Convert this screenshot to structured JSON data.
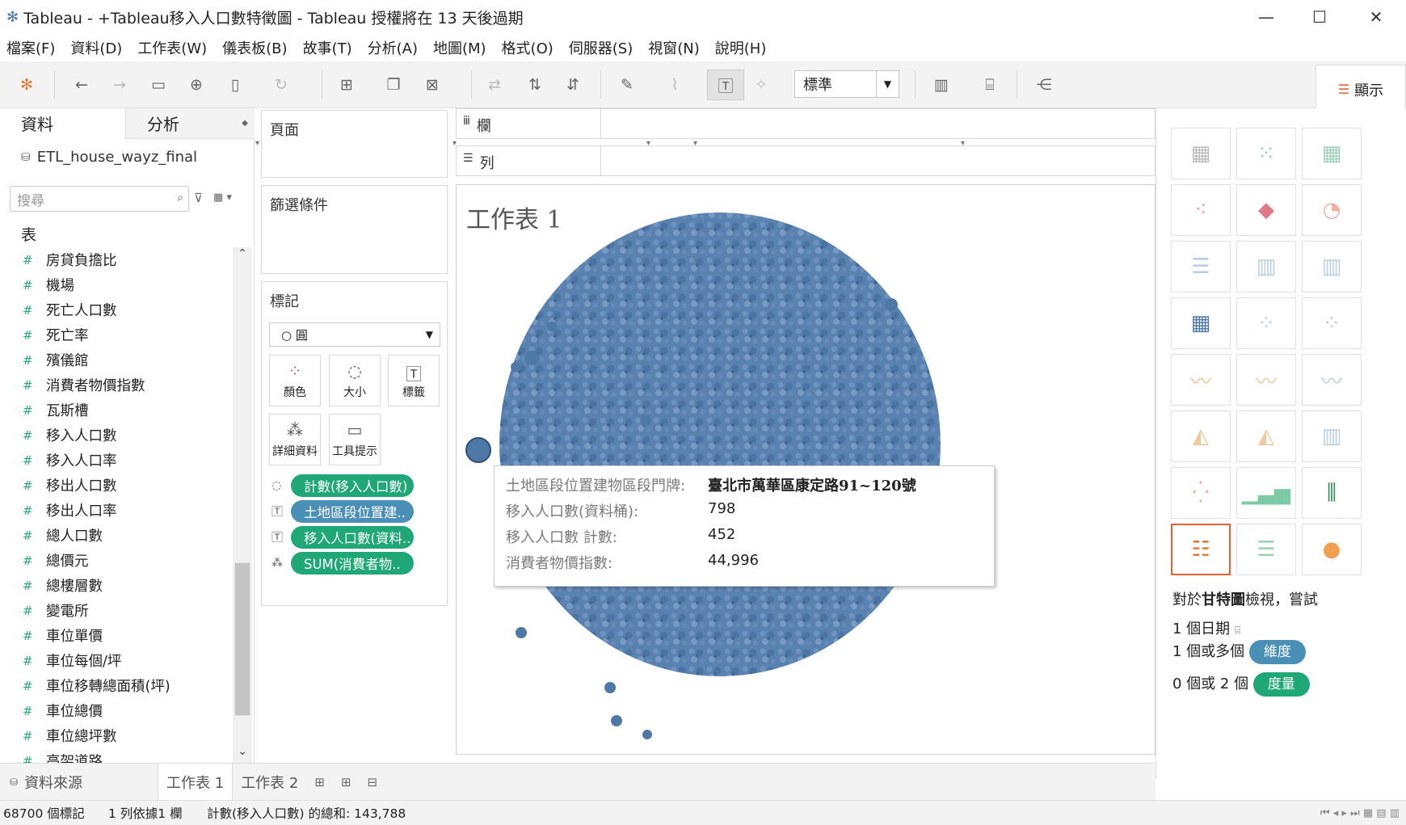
{
  "window": {
    "title": "Tableau - +Tableau移入人口數特徵圖 - Tableau 授權將在 13 天後過期",
    "minimize": "—",
    "maximize": "☐",
    "close": "✕"
  },
  "menu": [
    "檔案(F)",
    "資料(D)",
    "工作表(W)",
    "儀表板(B)",
    "故事(T)",
    "分析(A)",
    "地圖(M)",
    "格式(O)",
    "伺服器(S)",
    "視窗(N)",
    "說明(H)"
  ],
  "toolbar": {
    "fit_value": "標準",
    "show_me_label": "顯示"
  },
  "left": {
    "tab_data": "資料",
    "tab_analysis": "分析",
    "datasource": "ETL_house_wayz_final",
    "search_placeholder": "搜尋",
    "tables_label": "表",
    "fields": [
      "房貸負擔比",
      "機場",
      "死亡人口數",
      "死亡率",
      "殯儀館",
      "消費者物價指數",
      "瓦斯槽",
      "移入人口數",
      "移入人口率",
      "移出人口數",
      "移出人口率",
      "總人口數",
      "總價元",
      "總樓層數",
      "變電所",
      "車位單價",
      "車位每個/坪",
      "車位移轉總面積(坪)",
      "車位總價",
      "車位總坪數",
      "高架道路"
    ]
  },
  "cards": {
    "pages": "頁面",
    "filters": "篩選條件",
    "marks": "標記",
    "mark_type": "○ 圓",
    "mark_buttons": [
      "顏色",
      "大小",
      "標籤",
      "詳細資料",
      "工具提示"
    ],
    "pills": [
      {
        "text": "計數(移入人口數)",
        "color": "green"
      },
      {
        "text": "土地區段位置建..",
        "color": "blue"
      },
      {
        "text": "移入人口數(資料..",
        "color": "green"
      },
      {
        "text": "SUM(消費者物..",
        "color": "green"
      }
    ]
  },
  "shelves": {
    "columns": "欄",
    "rows": "列"
  },
  "viz": {
    "title": "工作表 1",
    "tooltip": [
      {
        "k": "土地區段位置建物區段門牌:",
        "v": "臺北市萬華區康定路91~120號"
      },
      {
        "k": "移入人口數(資料桶):",
        "v": "798"
      },
      {
        "k": "移入人口數 計數:",
        "v": "452"
      },
      {
        "k": "消費者物價指數:",
        "v": "44,996"
      }
    ]
  },
  "showme": {
    "hint_title_pre": "對於",
    "hint_title_bold": "甘特圖",
    "hint_title_post": "檢視，嘗試",
    "hint1": "1 個日期",
    "hint2": "1 個或多個",
    "hint2_pill": "維度",
    "hint3": "0 個或 2 個",
    "hint3_pill": "度量"
  },
  "sheets": {
    "datasource_tab": "資料來源",
    "tabs": [
      "工作表 1",
      "工作表 2"
    ]
  },
  "status": {
    "marks": "68700 個標記",
    "rows_cols": "1 列依據1 欄",
    "sum": "計數(移入人口數) 的總和: 143,788"
  },
  "colors": {
    "mark": "#4e79a7",
    "green_pill": "#1fa777",
    "blue_pill": "#4a8fb5",
    "accent": "#e8602c"
  }
}
